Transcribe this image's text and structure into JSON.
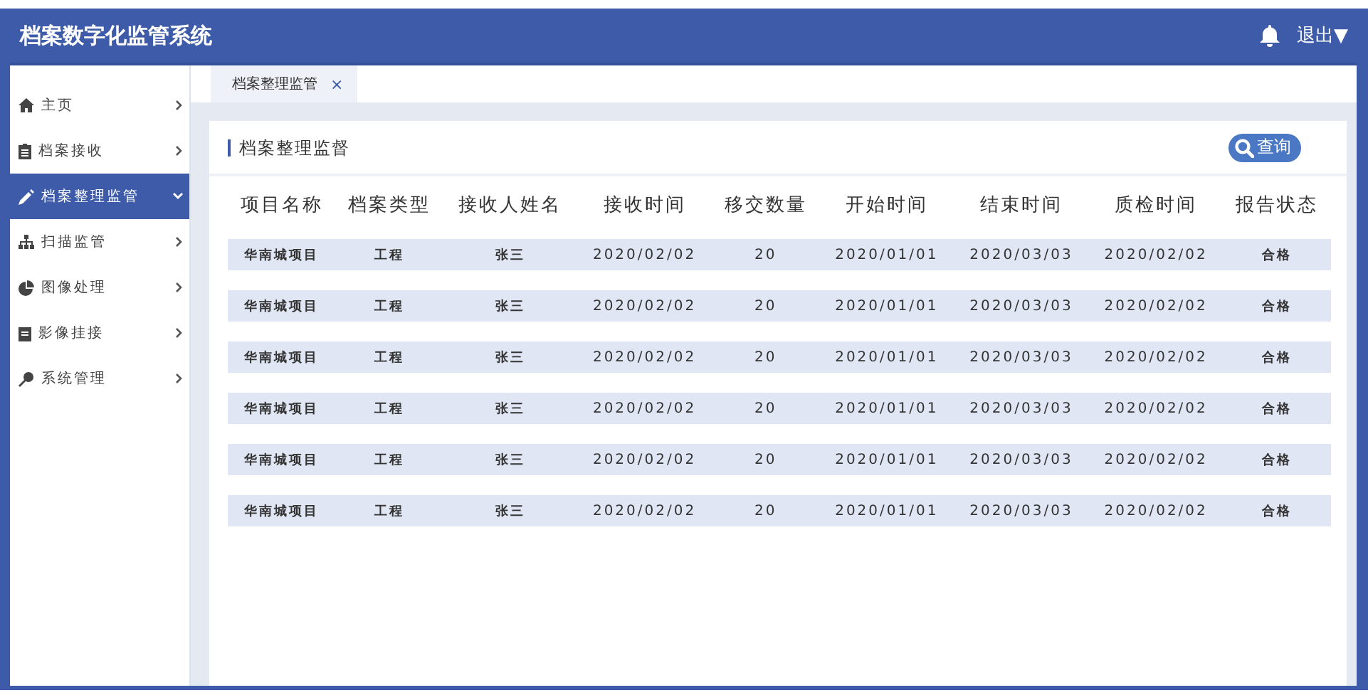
{
  "header": {
    "title": "档案数字化监管系统",
    "logout": "退出▼"
  },
  "sidebar": {
    "items": [
      {
        "label": "主页",
        "selected": false
      },
      {
        "label": "档案接收",
        "selected": false
      },
      {
        "label": "档案整理监管",
        "selected": true
      },
      {
        "label": "扫描监管",
        "selected": false
      },
      {
        "label": "图像处理",
        "selected": false
      },
      {
        "label": "影像挂接",
        "selected": false
      },
      {
        "label": "系统管理",
        "selected": false
      }
    ]
  },
  "tabs": [
    {
      "label": "档案整理监管",
      "selected": true,
      "close": "×"
    }
  ],
  "panel": {
    "title": "档案整理监督",
    "query_button": "查询"
  },
  "table": {
    "columns": [
      "项目名称",
      "档案类型",
      "接收人姓名",
      "接收时间",
      "移交数量",
      "开始时间",
      "结束时间",
      "质检时间",
      "报告状态"
    ],
    "rows": [
      [
        "华南城项目",
        "工程",
        "张三",
        "2020/02/02",
        "20",
        "2020/01/01",
        "2020/03/03",
        "2020/02/02",
        "合格"
      ],
      [
        "华南城项目",
        "工程",
        "张三",
        "2020/02/02",
        "20",
        "2020/01/01",
        "2020/03/03",
        "2020/02/02",
        "合格"
      ],
      [
        "华南城项目",
        "工程",
        "张三",
        "2020/02/02",
        "20",
        "2020/01/01",
        "2020/03/03",
        "2020/02/02",
        "合格"
      ],
      [
        "华南城项目",
        "工程",
        "张三",
        "2020/02/02",
        "20",
        "2020/01/01",
        "2020/03/03",
        "2020/02/02",
        "合格"
      ],
      [
        "华南城项目",
        "工程",
        "张三",
        "2020/02/02",
        "20",
        "2020/01/01",
        "2020/03/03",
        "2020/02/02",
        "合格"
      ],
      [
        "华南城项目",
        "工程",
        "张三",
        "2020/02/02",
        "20",
        "2020/01/01",
        "2020/03/03",
        "2020/02/02",
        "合格"
      ]
    ]
  }
}
